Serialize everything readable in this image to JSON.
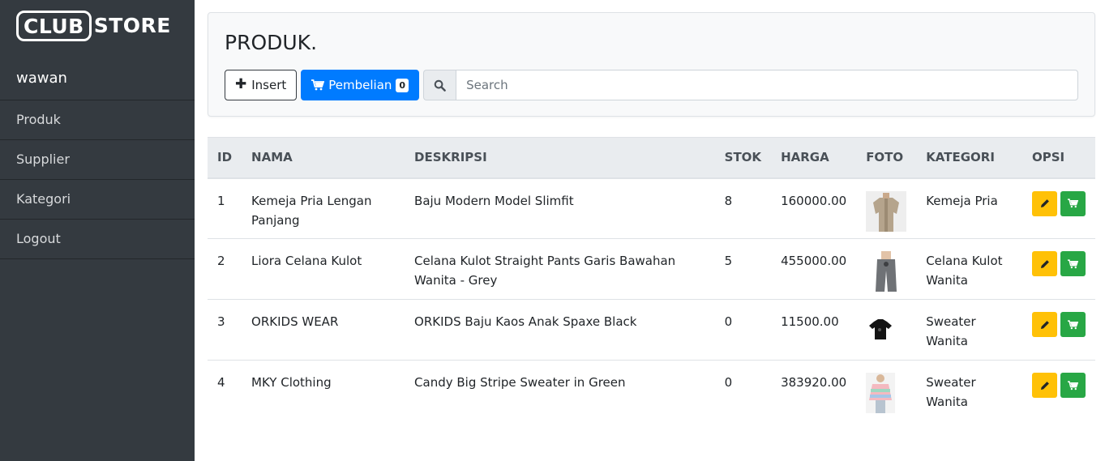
{
  "brand": {
    "part1": "CLUB",
    "part2": "STORE"
  },
  "user": {
    "name": "wawan"
  },
  "nav": [
    {
      "label": "Produk"
    },
    {
      "label": "Supplier"
    },
    {
      "label": "Kategori"
    },
    {
      "label": "Logout"
    }
  ],
  "page": {
    "title": "PRODUK."
  },
  "toolbar": {
    "insert_label": "Insert",
    "pembelian_label": "Pembelian",
    "pembelian_count": "0",
    "search_placeholder": "Search"
  },
  "table": {
    "headers": [
      "ID",
      "NAMA",
      "DESKRIPSI",
      "STOK",
      "HARGA",
      "FOTO",
      "KATEGORI",
      "OPSI"
    ],
    "rows": [
      {
        "id": "1",
        "nama": "Kemeja Pria Lengan Panjang",
        "deskripsi": "Baju Modern Model Slimfit",
        "stok": "8",
        "harga": "160000.00",
        "kategori": "Kemeja Pria"
      },
      {
        "id": "2",
        "nama": "Liora Celana Kulot",
        "deskripsi": "Celana Kulot Straight Pants Garis Bawahan Wanita - Grey",
        "stok": "5",
        "harga": "455000.00",
        "kategori": "Celana Kulot Wanita"
      },
      {
        "id": "3",
        "nama": "ORKIDS WEAR",
        "deskripsi": "ORKIDS Baju Kaos Anak Spaxe Black",
        "stok": "0",
        "harga": "11500.00",
        "kategori": "Sweater Wanita"
      },
      {
        "id": "4",
        "nama": "MKY Clothing",
        "deskripsi": "Candy Big Stripe Sweater in Green",
        "stok": "0",
        "harga": "383920.00",
        "kategori": "Sweater Wanita"
      }
    ]
  },
  "colors": {
    "sidebar_bg": "#343a40",
    "primary": "#007bff",
    "warning": "#ffc107",
    "success": "#28a745"
  }
}
